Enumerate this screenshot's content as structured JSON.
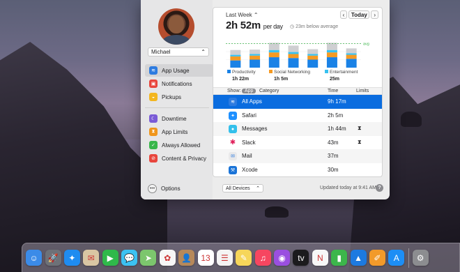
{
  "sidebar": {
    "user_name": "Michael",
    "items": [
      {
        "label": "App Usage",
        "icon": "layers-icon",
        "color": "#2d7be0"
      },
      {
        "label": "Notifications",
        "icon": "notification-icon",
        "color": "#e8453c"
      },
      {
        "label": "Pickups",
        "icon": "bell-icon",
        "color": "#f3b61f"
      },
      {
        "label": "Downtime",
        "icon": "moon-icon",
        "color": "#7a5bd6"
      },
      {
        "label": "App Limits",
        "icon": "hourglass-icon",
        "color": "#f0961c"
      },
      {
        "label": "Always Allowed",
        "icon": "check-icon",
        "color": "#38b64a"
      },
      {
        "label": "Content & Privacy",
        "icon": "restriction-icon",
        "color": "#e8453c"
      }
    ],
    "options_label": "Options"
  },
  "header": {
    "period": "Last Week",
    "today_label": "Today",
    "total": "2h 52m",
    "per_day": "per day",
    "average_note": "23m below average"
  },
  "chart_data": {
    "type": "bar",
    "stacked": true,
    "categories": [
      "Sun",
      "Mon",
      "Tue",
      "Wed",
      "Thu",
      "Fri",
      "Sat"
    ],
    "series": [
      {
        "name": "Productivity",
        "color": "#1a82e6",
        "values": [
          0.9,
          1.0,
          1.3,
          1.2,
          1.0,
          1.3,
          1.1
        ]
      },
      {
        "name": "Social Networking",
        "color": "#f59a22",
        "values": [
          0.5,
          0.5,
          0.6,
          0.5,
          0.5,
          0.6,
          0.5
        ]
      },
      {
        "name": "Entertainment",
        "color": "#38c1f0",
        "values": [
          0.2,
          0.2,
          0.3,
          0.25,
          0.2,
          0.3,
          0.2
        ]
      },
      {
        "name": "Other",
        "color": "#cfcfd2",
        "values": [
          0.6,
          0.55,
          0.9,
          0.8,
          0.6,
          0.9,
          0.6
        ]
      }
    ],
    "average_label": "avg",
    "average_value": 3.0,
    "ylim": [
      0,
      4
    ]
  },
  "legend": [
    {
      "name": "Productivity",
      "time": "1h 22m",
      "color": "#1a82e6"
    },
    {
      "name": "Social Networking",
      "time": "1h 5m",
      "color": "#f59a22"
    },
    {
      "name": "Entertainment",
      "time": "25m",
      "color": "#38c1f0"
    }
  ],
  "table": {
    "show_label": "Show:",
    "app_label": "App",
    "category_label": "Category",
    "time_header": "Time",
    "limits_header": "Limits",
    "rows": [
      {
        "name": "All Apps",
        "time": "9h 17m",
        "limit": "",
        "icon": "stack-icon",
        "color": "#2d7be0"
      },
      {
        "name": "Safari",
        "time": "2h 5m",
        "limit": "",
        "icon": "compass-icon",
        "color": "#1e90ff"
      },
      {
        "name": "Messages",
        "time": "1h 44m",
        "limit": "⧗",
        "icon": "message-icon",
        "color": "#34c0eb"
      },
      {
        "name": "Slack",
        "time": "43m",
        "limit": "⧗",
        "icon": "slack-icon",
        "color": "#4a154b"
      },
      {
        "name": "Mail",
        "time": "37m",
        "limit": "",
        "icon": "envelope-icon",
        "color": "#e9e9ea"
      },
      {
        "name": "Xcode",
        "time": "30m",
        "limit": "",
        "icon": "hammer-icon",
        "color": "#1a74d8"
      }
    ]
  },
  "footer": {
    "devices": "All Devices",
    "updated": "Updated today at 9:41 AM",
    "help": "?"
  },
  "dock": {
    "apps": [
      {
        "icon": "finder-icon",
        "color": "#3b8be8",
        "glyph": "☺",
        "running": true
      },
      {
        "icon": "launchpad-icon",
        "color": "#6d7178",
        "glyph": "🚀"
      },
      {
        "icon": "safari-icon",
        "color": "#1f8cf0",
        "glyph": "✦"
      },
      {
        "icon": "mail-stamp-icon",
        "color": "#d9c6a3",
        "glyph": "✉"
      },
      {
        "icon": "facetime-icon",
        "color": "#2fb94a",
        "glyph": "▶"
      },
      {
        "icon": "messages-icon",
        "color": "#3cc2f2",
        "glyph": "💬"
      },
      {
        "icon": "maps-icon",
        "color": "#7cc66d",
        "glyph": "➤"
      },
      {
        "icon": "photos-icon",
        "color": "#f7f7f7",
        "glyph": "✿"
      },
      {
        "icon": "contacts-icon",
        "color": "#b7895a",
        "glyph": "👤"
      },
      {
        "icon": "calendar-icon",
        "color": "#ffffff",
        "glyph": "13"
      },
      {
        "icon": "reminders-icon",
        "color": "#f4f4f4",
        "glyph": "☰"
      },
      {
        "icon": "notes-icon",
        "color": "#f6d65a",
        "glyph": "✎"
      },
      {
        "icon": "music-icon",
        "color": "#f64660",
        "glyph": "♫"
      },
      {
        "icon": "podcasts-icon",
        "color": "#9a4fe0",
        "glyph": "◉"
      },
      {
        "icon": "apple-tv-icon",
        "color": "#1b1b1d",
        "glyph": "tv"
      },
      {
        "icon": "news-icon",
        "color": "#f7f7f7",
        "glyph": "N"
      },
      {
        "icon": "numbers-icon",
        "color": "#3cb64b",
        "glyph": "▮"
      },
      {
        "icon": "keynote-icon",
        "color": "#1d7ae0",
        "glyph": "▲"
      },
      {
        "icon": "pages-icon",
        "color": "#f29a2a",
        "glyph": "✐"
      },
      {
        "icon": "app-store-icon",
        "color": "#1d8ef5",
        "glyph": "A"
      },
      {
        "icon": "system-preferences-icon",
        "color": "#8c8d90",
        "glyph": "⚙",
        "running": true
      }
    ]
  }
}
